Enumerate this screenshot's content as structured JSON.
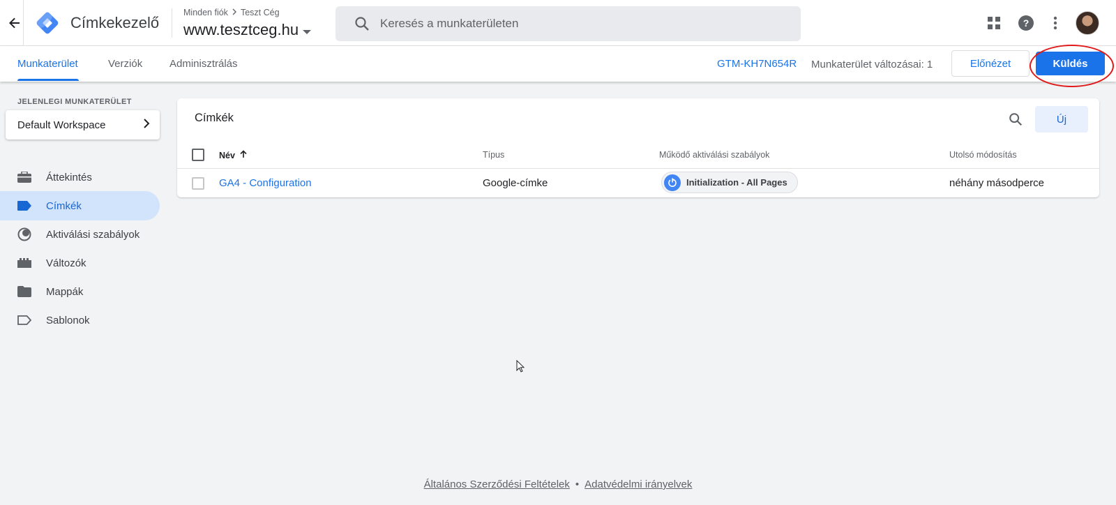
{
  "header": {
    "app_title": "Címkekezelő",
    "breadcrumb_account": "Minden fiók",
    "breadcrumb_company": "Teszt Cég",
    "container_name": "www.tesztceg.hu",
    "search_placeholder": "Keresés a munkaterületen"
  },
  "tabs": [
    {
      "label": "Munkaterület",
      "active": true
    },
    {
      "label": "Verziók",
      "active": false
    },
    {
      "label": "Adminisztrálás",
      "active": false
    }
  ],
  "toolbar": {
    "container_id": "GTM-KH7N654R",
    "workspace_changes": "Munkaterület változásai: 1",
    "preview_label": "Előnézet",
    "send_label": "Küldés"
  },
  "sidebar": {
    "current_workspace_label": "JELENLEGI MUNKATERÜLET",
    "workspace_name": "Default Workspace",
    "items": [
      {
        "label": "Áttekintés",
        "icon": "briefcase-icon",
        "active": false
      },
      {
        "label": "Címkék",
        "icon": "tag-icon",
        "active": true
      },
      {
        "label": "Aktiválási szabályok",
        "icon": "trigger-icon",
        "active": false
      },
      {
        "label": "Változók",
        "icon": "variables-icon",
        "active": false
      },
      {
        "label": "Mappák",
        "icon": "folder-icon",
        "active": false
      },
      {
        "label": "Sablonok",
        "icon": "template-icon",
        "active": false
      }
    ]
  },
  "tags_card": {
    "title": "Címkék",
    "new_label": "Új",
    "columns": [
      "Név",
      "Típus",
      "Működő aktiválási szabályok",
      "Utolsó módosítás"
    ],
    "rows": [
      {
        "name": "GA4 - Configuration",
        "type": "Google-címke",
        "trigger": "Initialization - All Pages",
        "modified": "néhány másodperce"
      }
    ]
  },
  "footer": {
    "terms": "Általános Szerződési Feltételek",
    "separator": "•",
    "privacy": "Adatvédelmi irányelvek"
  },
  "colors": {
    "accent": "#1a73e8",
    "highlight": "#e01a1a"
  }
}
